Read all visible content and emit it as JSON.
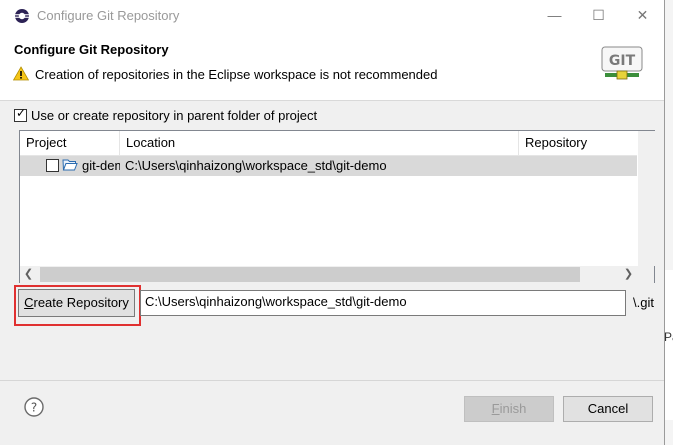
{
  "window": {
    "title": "Configure Git Repository",
    "minimize_glyph": "—",
    "maximize_glyph": "☐",
    "close_glyph": "✕"
  },
  "banner": {
    "title": "Configure Git Repository",
    "message": "Creation of repositories in the Eclipse workspace is not recommended",
    "logo_text": "GIT"
  },
  "options": {
    "parent_folder_checked": true,
    "parent_folder_label": "Use or create repository in parent folder of project"
  },
  "table": {
    "columns": [
      "Project",
      "Location",
      "Repository"
    ],
    "rows": [
      {
        "checked": false,
        "project": "git-demo",
        "location": "C:\\Users\\qinhaizong\\workspace_std\\git-demo",
        "repository": ""
      }
    ]
  },
  "create": {
    "button_label_first": "C",
    "button_label_rest": "reate Repository",
    "path_value": "C:\\Users\\qinhaizong\\workspace_std\\git-demo",
    "suffix": "\\.git"
  },
  "footer": {
    "finish_first": "F",
    "finish_rest": "inish",
    "cancel_label": "Cancel"
  },
  "background": {
    "partial_text": "Pa"
  },
  "colors": {
    "highlight": "#e03030",
    "selected_row": "#d9d9d9",
    "warning": "#f5c518"
  }
}
